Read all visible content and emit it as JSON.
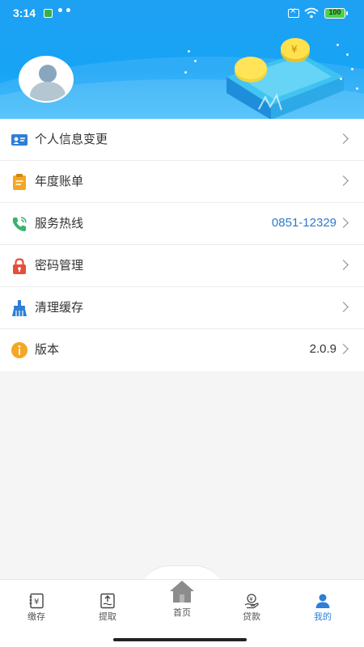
{
  "status_bar": {
    "time": "3:14",
    "dots": "••",
    "battery": "100"
  },
  "menu": {
    "items": [
      {
        "label": "个人信息变更",
        "value": "",
        "icon": "id-card-icon"
      },
      {
        "label": "年度账单",
        "value": "",
        "icon": "clipboard-icon"
      },
      {
        "label": "服务热线",
        "value": "0851-12329",
        "icon": "phone-icon"
      },
      {
        "label": "密码管理",
        "value": "",
        "icon": "lock-icon"
      },
      {
        "label": "清理缓存",
        "value": "",
        "icon": "broom-icon"
      },
      {
        "label": "版本",
        "value": "2.0.9",
        "icon": "info-icon"
      }
    ]
  },
  "tabbar": {
    "items": [
      {
        "label": "缴存",
        "icon": "deposit-book-icon"
      },
      {
        "label": "提取",
        "icon": "withdraw-upload-icon"
      },
      {
        "label": "首页",
        "icon": "home-icon"
      },
      {
        "label": "贷款",
        "icon": "loan-hand-icon"
      },
      {
        "label": "我的",
        "icon": "person-icon"
      }
    ],
    "active_index": 4
  },
  "colors": {
    "banner": "#1ea0f3",
    "accent": "#2e7fd9",
    "hotline": "#2f79c9"
  }
}
